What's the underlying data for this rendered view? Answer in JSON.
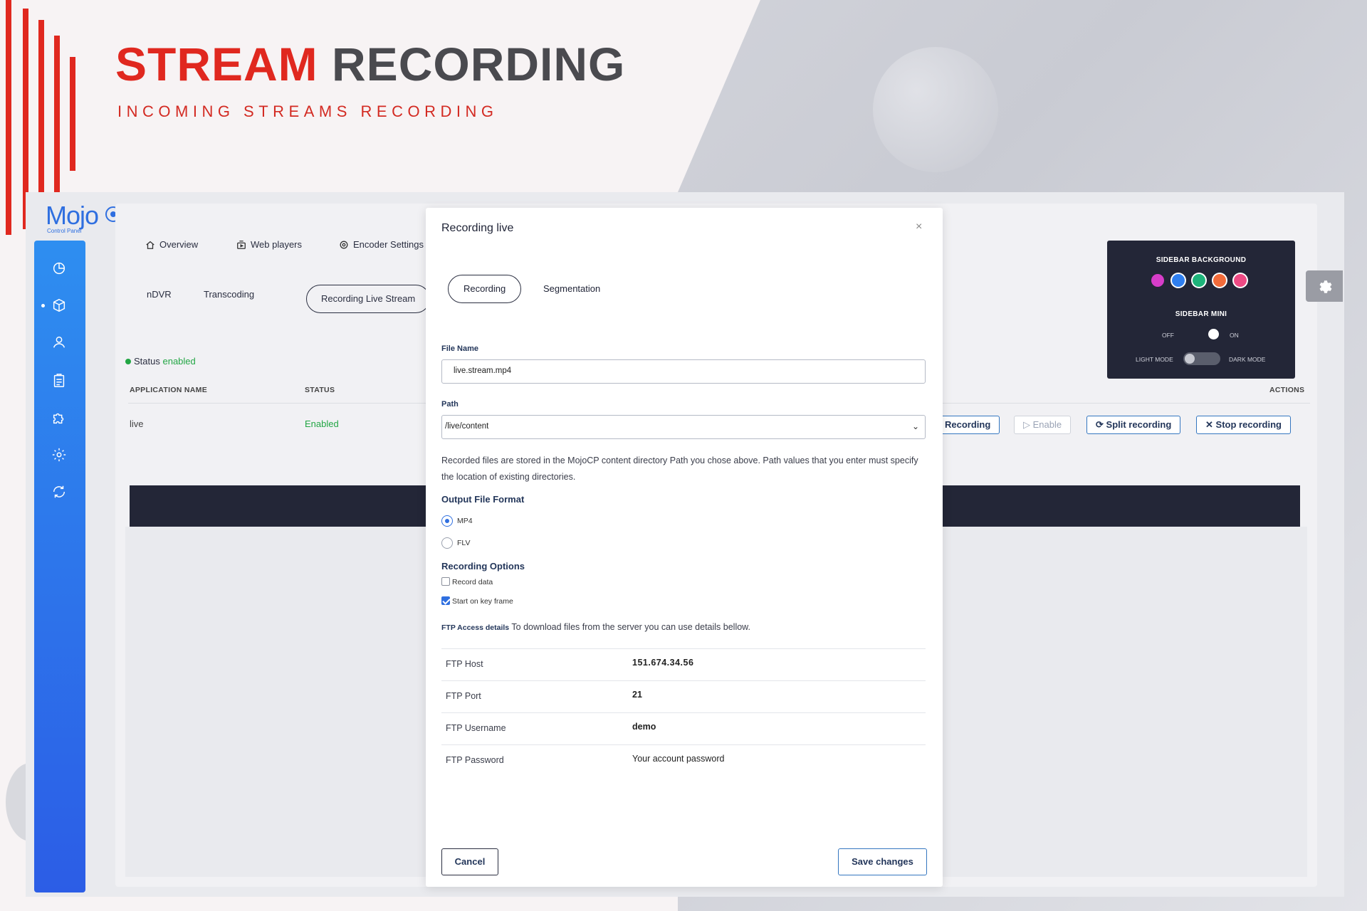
{
  "hero": {
    "title_accent": "STREAM",
    "title_rest": "RECORDING",
    "subtitle": "INCOMING STREAMS RECORDING"
  },
  "app": {
    "logo_text": "Mojo",
    "logo_sub": "Control Panel",
    "sidebar_icons": [
      "dashboard-icon",
      "cube-icon",
      "user-icon",
      "clipboard-icon",
      "puzzle-icon",
      "gear-icon",
      "refresh-icon"
    ],
    "top_nav": [
      {
        "label": "Overview",
        "icon": "home-icon"
      },
      {
        "label": "Web players",
        "icon": "player-icon"
      },
      {
        "label": "Encoder Settings",
        "icon": "settings-icon"
      }
    ],
    "sub_tabs": {
      "ndvr": "nDVR",
      "transcoding": "Transcoding",
      "recording_live": "Recording Live Stream"
    },
    "status": {
      "label": "Status",
      "value": "enabled"
    },
    "table": {
      "headers": {
        "app_name": "APPLICATION NAME",
        "status": "STATUS",
        "actions": "ACTIONS"
      },
      "rows": [
        {
          "app_name": "live",
          "status": "Enabled"
        }
      ]
    },
    "actions": {
      "start": "Recording",
      "enable": "Enable",
      "split": "Split recording",
      "stop": "Stop recording"
    },
    "colors": {
      "accent": "#2f6fe0",
      "enabled": "#22a644",
      "dark": "#232637"
    }
  },
  "theme_panel": {
    "sidebar_background": "SIDEBAR BACKGROUND",
    "swatches": [
      "#d73dc9",
      "#2f7ff0",
      "#1db37a",
      "#f26b3a",
      "#ee4a84"
    ],
    "sidebar_mini": "SIDEBAR MINI",
    "off": "OFF",
    "on": "ON",
    "light_mode": "LIGHT MODE",
    "dark_mode": "DARK MODE"
  },
  "modal": {
    "title": "Recording live",
    "close": "×",
    "tabs": {
      "recording": "Recording",
      "segmentation": "Segmentation"
    },
    "file_name": {
      "label": "File Name",
      "value": "live.stream.mp4"
    },
    "path": {
      "label": "Path",
      "value": "/live/content"
    },
    "description": "Recorded files are stored in the MojoCP content directory Path you chose above. Path values that you enter must specify the location of existing directories.",
    "output_format": {
      "heading": "Output File Format",
      "options": [
        "MP4",
        "FLV"
      ],
      "selected": "MP4"
    },
    "recording_options": {
      "heading": "Recording Options",
      "record_data": {
        "label": "Record data",
        "checked": false
      },
      "start_key_frame": {
        "label": "Start on key frame",
        "checked": true
      }
    },
    "ftp": {
      "intro_bold": "FTP Access details",
      "intro_text": "To download files from the server you can use details bellow.",
      "rows": [
        {
          "key": "FTP Host",
          "value": "151.674.34.56"
        },
        {
          "key": "FTP Port",
          "value": "21"
        },
        {
          "key": "FTP Username",
          "value": "demo"
        },
        {
          "key": "FTP Password",
          "value": "Your account password"
        }
      ]
    },
    "cancel": "Cancel",
    "save": "Save changes"
  }
}
